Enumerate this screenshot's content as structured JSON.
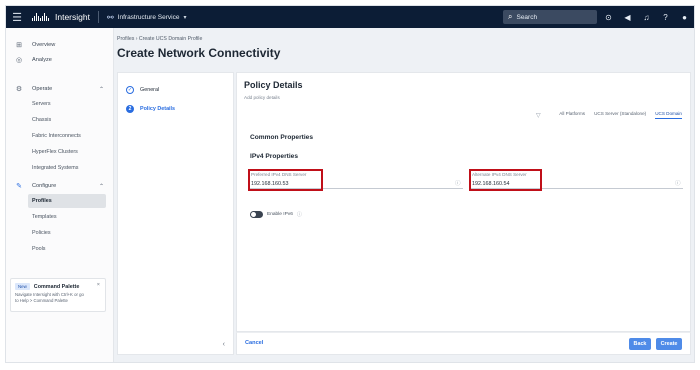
{
  "topbar": {
    "menu_icon": "hamburger-icon",
    "brand_logo": "cisco-logo",
    "brand": "Intersight",
    "service": "Infrastructure Service",
    "service_icon": "service-icon",
    "search_placeholder": "Search",
    "icons": [
      "task-check-icon",
      "announcement-icon",
      "notification-bell-icon",
      "help-icon",
      "user-icon"
    ]
  },
  "sidebar": {
    "overview": "Overview",
    "analyze": "Analyze",
    "operate": "Operate",
    "operate_items": [
      "Servers",
      "Chassis",
      "Fabric Interconnects",
      "HyperFlex Clusters",
      "Integrated Systems"
    ],
    "configure": "Configure",
    "configure_items": [
      "Profiles",
      "Templates",
      "Policies",
      "Pools"
    ],
    "palette": {
      "badge": "New",
      "title": "Command Palette",
      "desc_line1": "Navigate Intersight with Ctrl+K or go",
      "desc_line2": "to Help > Command Palette",
      "close": "×"
    }
  },
  "breadcrumb": "Profiles  ›  Create UCS Domain Profile",
  "page_title": "Create Network Connectivity",
  "steps": [
    {
      "number": "✓",
      "label": "General",
      "state": "done"
    },
    {
      "number": "2",
      "label": "Policy Details",
      "state": "current"
    }
  ],
  "collapse_icon": "‹",
  "policy": {
    "title": "Policy Details",
    "subtitle": "Add policy details",
    "platform_tabs": [
      "All Platforms",
      "UCS Server (Standalone)",
      "UCS Domain"
    ],
    "selected_tab": "UCS Domain",
    "common_properties": "Common Properties",
    "ipv4_properties": "IPv4 Properties",
    "preferred_dns_label": "Preferred IPv4 DNS Server",
    "preferred_dns_value": "192.168.160.53",
    "alternate_dns_label": "Alternate IPv4 DNS Server",
    "alternate_dns_value": "192.168.160.54",
    "enable_ipv6": "Enable IPv6",
    "info_icon": "info-icon"
  },
  "footer": {
    "cancel": "Cancel",
    "back": "Back",
    "create": "Create"
  },
  "colors": {
    "topbar": "#0c1d36",
    "accent": "#2a6de0",
    "primary_button": "#4f8be8",
    "highlight_box": "#c00f19"
  }
}
